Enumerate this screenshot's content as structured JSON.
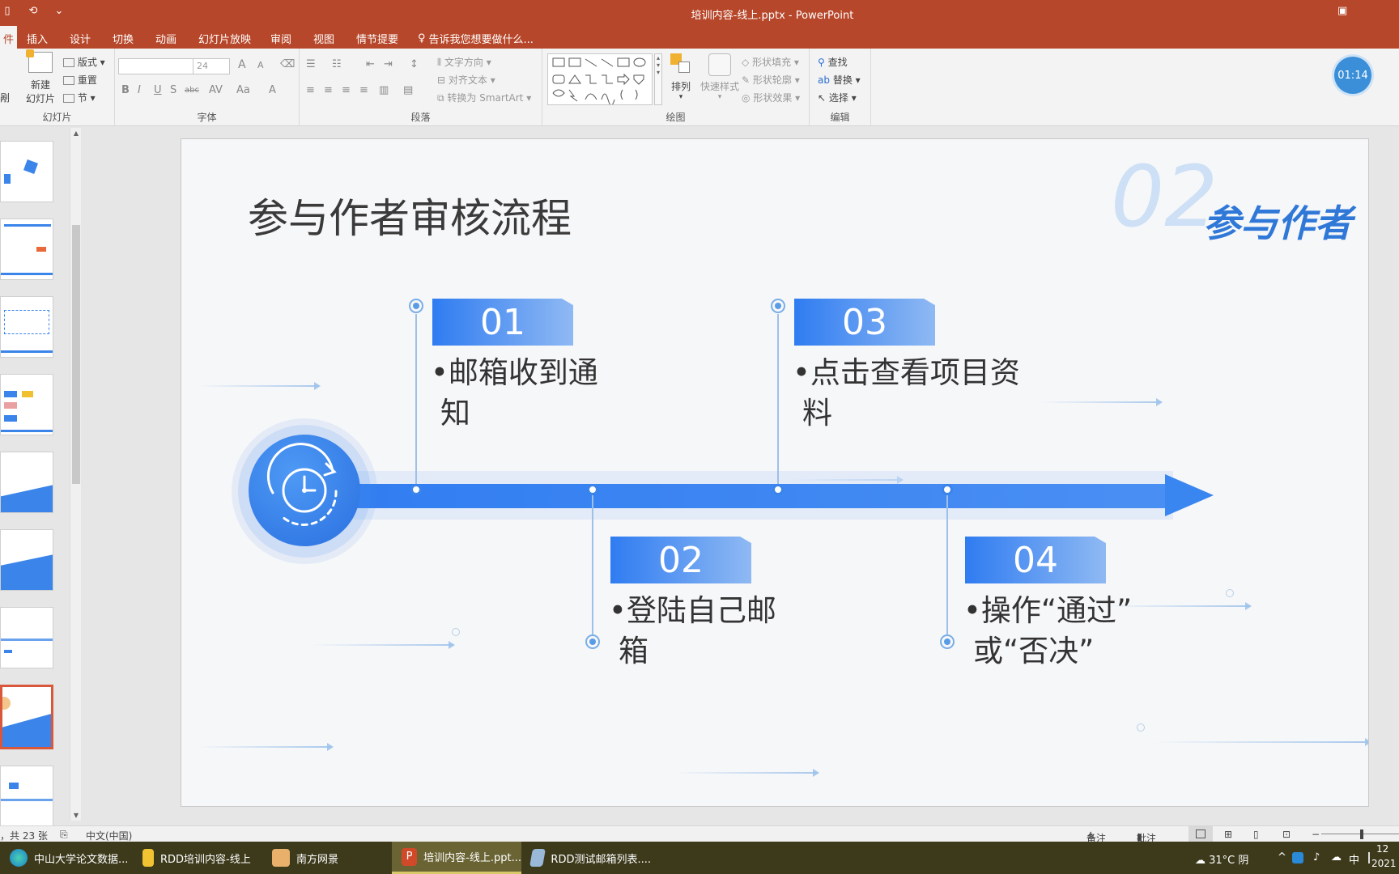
{
  "window": {
    "title": "培训内容-线上.pptx - PowerPoint"
  },
  "tabs": [
    {
      "label": "件"
    },
    {
      "label": "插入"
    },
    {
      "label": "设计"
    },
    {
      "label": "切换"
    },
    {
      "label": "动画"
    },
    {
      "label": "幻灯片放映"
    },
    {
      "label": "审阅"
    },
    {
      "label": "视图"
    },
    {
      "label": "情节提要"
    },
    {
      "label": "告诉我您想要做什么..."
    }
  ],
  "ribbon": {
    "slides": {
      "new_slide": "新建",
      "new_slide2": "幻灯片",
      "layout": "版式",
      "reset": "重置",
      "section": "节",
      "group_label": "幻灯片",
      "left_partial": "剐"
    },
    "font": {
      "size_value": "24",
      "group_label": "字体",
      "bold": "B",
      "italic": "I",
      "underline": "U",
      "shadow": "S",
      "strike": "abc",
      "spacing": "AV",
      "case": "Aa",
      "color": "A",
      "grow": "A",
      "shrink": "A"
    },
    "paragraph": {
      "text_direction": "文字方向",
      "align_text": "对齐文本",
      "convert_smartart": "转换为 SmartArt",
      "group_label": "段落"
    },
    "drawing": {
      "arrange": "排列",
      "quick_styles": "快速样式",
      "shape_fill": "形状填充",
      "shape_outline": "形状轮廓",
      "shape_effects": "形状效果",
      "group_label": "绘图"
    },
    "editing": {
      "find": "查找",
      "replace": "替换",
      "select": "选择",
      "group_label": "编辑"
    }
  },
  "timer": "01:14",
  "slide": {
    "title": "参与作者审核流程",
    "section_number": "02",
    "section_badge": "参与作者",
    "steps": [
      {
        "num": "01",
        "line1": "•邮箱收到通",
        "line2": "知"
      },
      {
        "num": "02",
        "line1": "•登陆自己邮",
        "line2": "箱"
      },
      {
        "num": "03",
        "line1": "•点击查看项目资",
        "line2": "料"
      },
      {
        "num": "04",
        "line1": "•操作“通过”",
        "line2": "或“否决”"
      }
    ]
  },
  "status": {
    "slide_count": "，共 23 张",
    "language": "中文(中国)",
    "notes": "备注",
    "comments": "批注"
  },
  "taskbar": {
    "items": [
      {
        "label": "中山大学论文数据..."
      },
      {
        "label": "RDD培训内容-线上"
      },
      {
        "label": "南方网景"
      },
      {
        "label": "培训内容-线上.ppt..."
      },
      {
        "label": "RDD测试邮箱列表...."
      }
    ],
    "weather": "31°C 阴",
    "ime": "中",
    "time": "12",
    "date": "2021"
  },
  "colors": {
    "titlebar": "#b7472a",
    "accent_blue": "#2f7cf1"
  }
}
